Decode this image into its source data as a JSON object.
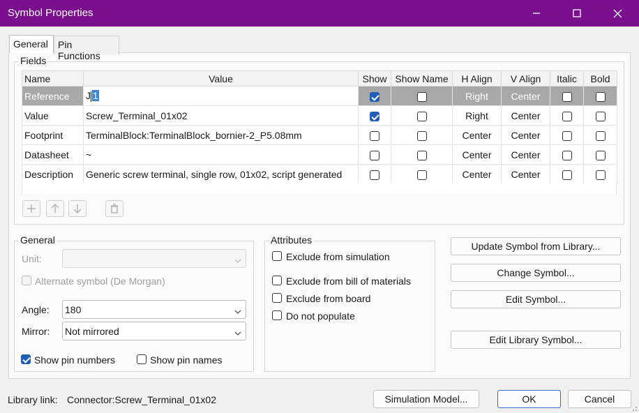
{
  "window": {
    "title": "Symbol Properties"
  },
  "tabs": [
    {
      "label": "General",
      "active": true
    },
    {
      "label": "Pin Functions",
      "active": false
    }
  ],
  "fields": {
    "group_label": "Fields",
    "columns": [
      "Name",
      "Value",
      "Show",
      "Show Name",
      "H Align",
      "V Align",
      "Italic",
      "Bold"
    ],
    "rows": [
      {
        "name": "Reference",
        "value_prefix": "J",
        "value_selected": "1",
        "value": "J1",
        "show": true,
        "show_name": false,
        "h_align": "Right",
        "v_align": "Center",
        "italic": false,
        "bold": false,
        "selected": true
      },
      {
        "name": "Value",
        "value": "Screw_Terminal_01x02",
        "show": true,
        "show_name": false,
        "h_align": "Right",
        "v_align": "Center",
        "italic": false,
        "bold": false
      },
      {
        "name": "Footprint",
        "value": "TerminalBlock:TerminalBlock_bornier-2_P5.08mm",
        "show": false,
        "show_name": false,
        "h_align": "Center",
        "v_align": "Center",
        "italic": false,
        "bold": false
      },
      {
        "name": "Datasheet",
        "value": "~",
        "show": false,
        "show_name": false,
        "h_align": "Center",
        "v_align": "Center",
        "italic": false,
        "bold": false
      },
      {
        "name": "Description",
        "value": "Generic screw terminal, single row, 01x02, script generated",
        "show": false,
        "show_name": false,
        "h_align": "Center",
        "v_align": "Center",
        "italic": false,
        "bold": false
      }
    ],
    "toolbar_icons": [
      "plus-icon",
      "arrow-up-icon",
      "arrow-down-icon",
      "trash-icon"
    ]
  },
  "general": {
    "group_label": "General",
    "unit_label": "Unit:",
    "unit_value": "",
    "alternate_label": "Alternate symbol (De Morgan)",
    "alternate_checked": false,
    "angle_label": "Angle:",
    "angle_value": "180",
    "mirror_label": "Mirror:",
    "mirror_value": "Not mirrored",
    "show_pin_numbers_label": "Show pin numbers",
    "show_pin_numbers": true,
    "show_pin_names_label": "Show pin names",
    "show_pin_names": false
  },
  "attributes": {
    "group_label": "Attributes",
    "items": [
      {
        "label": "Exclude from simulation",
        "checked": false
      },
      {
        "label": "Exclude from bill of materials",
        "checked": false
      },
      {
        "label": "Exclude from board",
        "checked": false
      },
      {
        "label": "Do not populate",
        "checked": false
      }
    ]
  },
  "actions": {
    "update_from_library": "Update Symbol from Library...",
    "change_symbol": "Change Symbol...",
    "edit_symbol": "Edit Symbol...",
    "edit_library_symbol": "Edit Library Symbol..."
  },
  "footer": {
    "library_link_label": "Library link:",
    "library_link_value": "Connector:Screw_Terminal_01x02",
    "simulation_model": "Simulation Model...",
    "ok": "OK",
    "cancel": "Cancel"
  },
  "colors": {
    "titlebar": "#7a0f8e",
    "accent": "#1f5fb8",
    "selected_row": "#a8a8a8"
  }
}
